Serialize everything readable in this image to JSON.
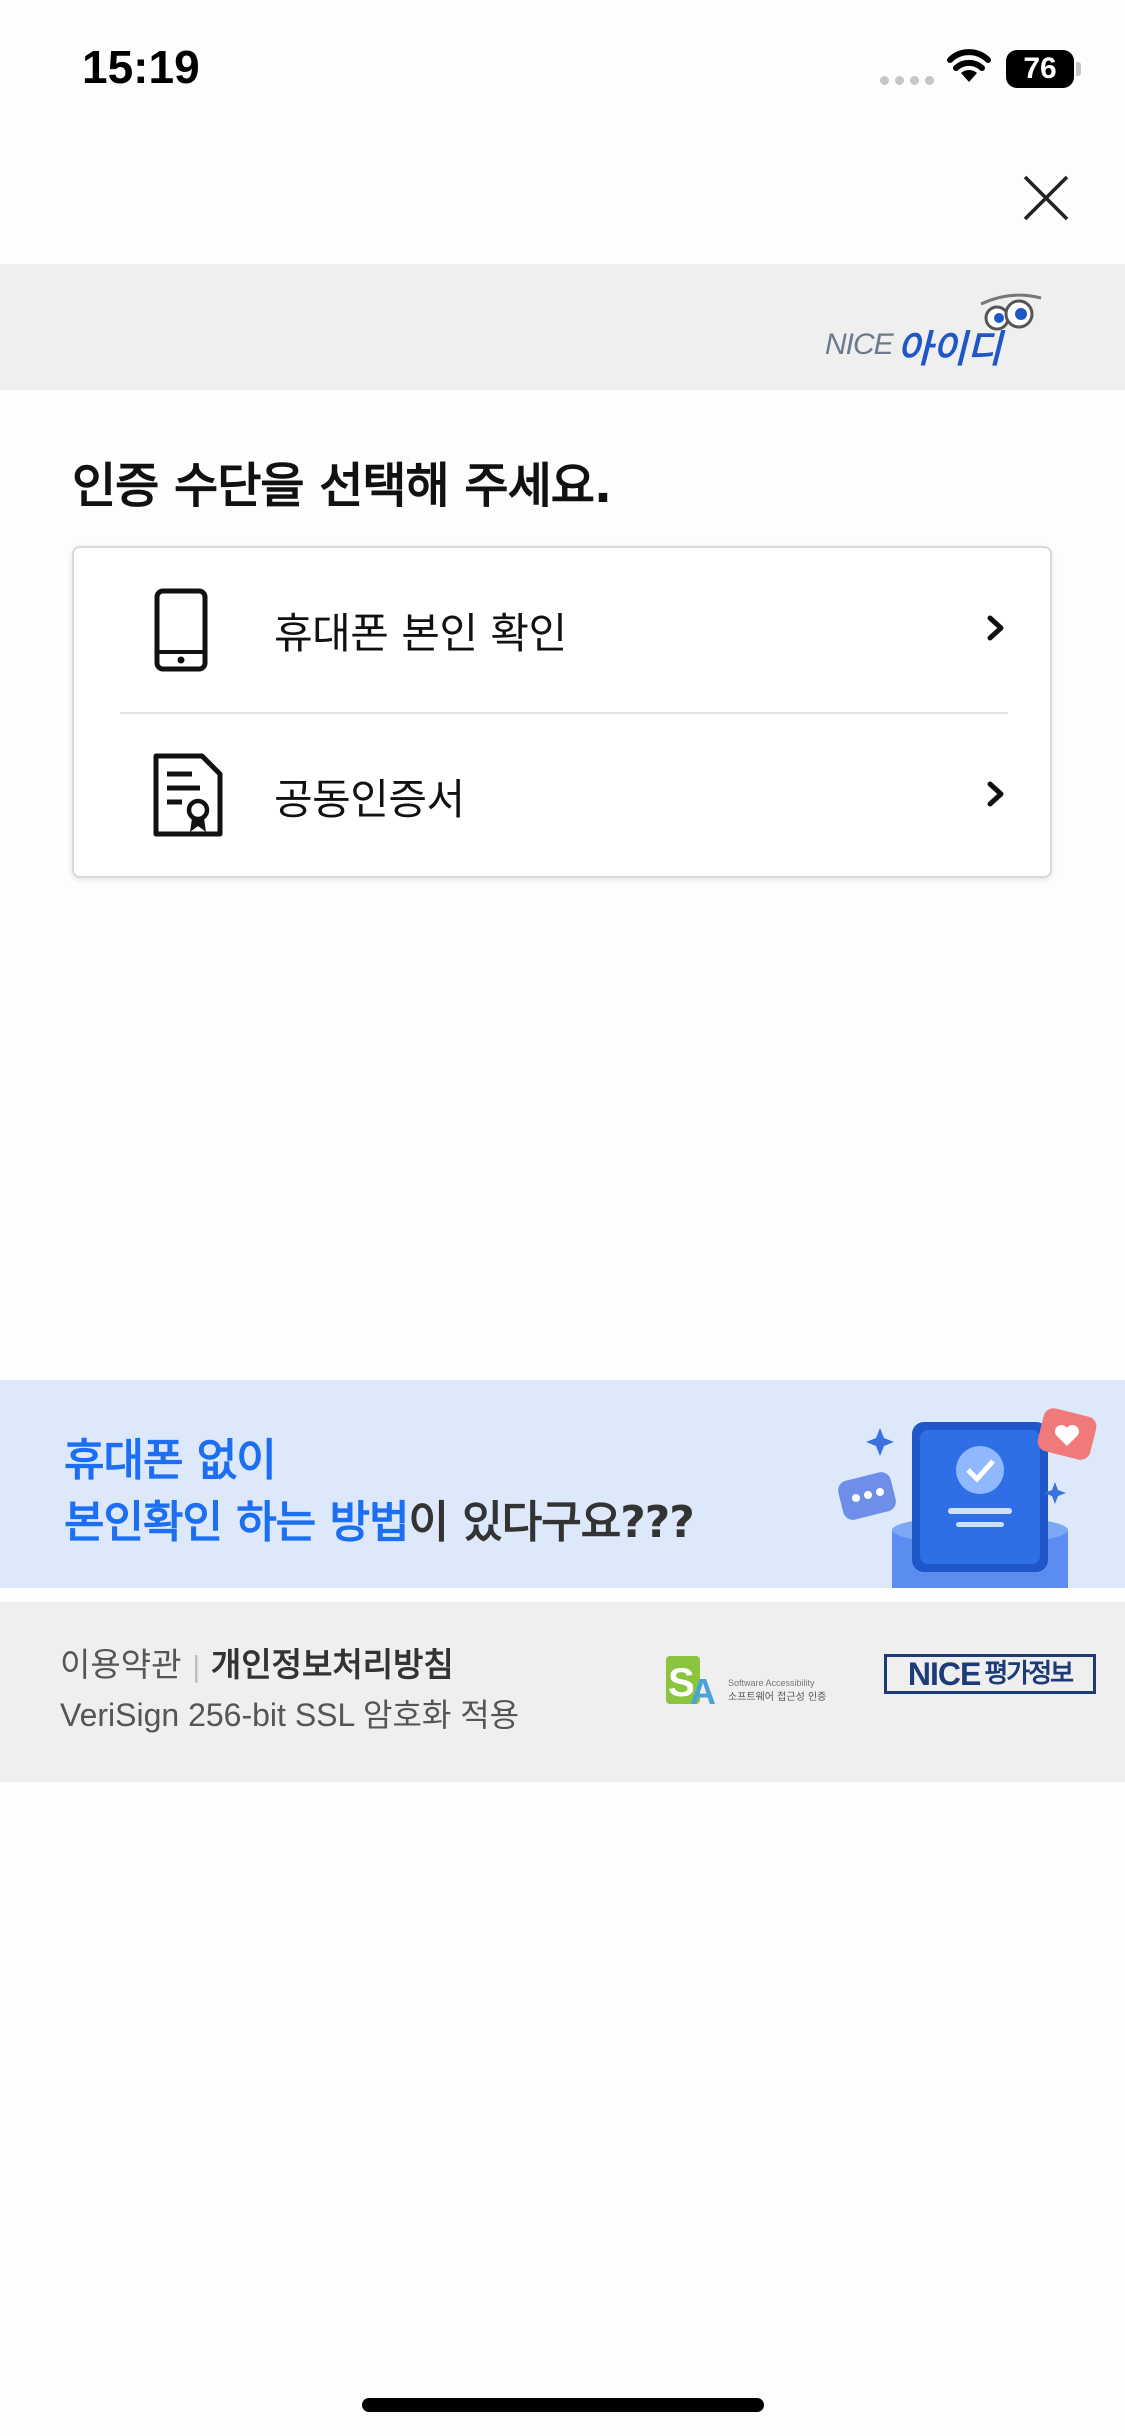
{
  "status_bar": {
    "time": "15:19",
    "battery": "76"
  },
  "header": {
    "close_icon": "close-icon"
  },
  "brand": {
    "logo_en": "NICE",
    "logo_ko": "아이디"
  },
  "main": {
    "title": "인증 수단을 선택해 주세요.",
    "methods": [
      {
        "label": "휴대폰 본인 확인",
        "icon": "phone-icon"
      },
      {
        "label": "공동인증서",
        "icon": "certificate-icon"
      }
    ]
  },
  "promo": {
    "line1": "휴대폰 없이",
    "line2_highlight": "본인확인 하는 방법",
    "line2_rest": "이 있다구요???",
    "colors": {
      "background": "#dde9fb",
      "accent": "#1c6ef2"
    }
  },
  "footer": {
    "terms": "이용약관",
    "privacy": "개인정보처리방침",
    "ssl": "VeriSign 256-bit SSL 암호화 적용",
    "sa_badge_line1": "Software Accessibility",
    "sa_badge_line2": "소프트웨어 접근성 인증",
    "nice_badge_en": "NICE",
    "nice_badge_ko": "평가정보"
  }
}
